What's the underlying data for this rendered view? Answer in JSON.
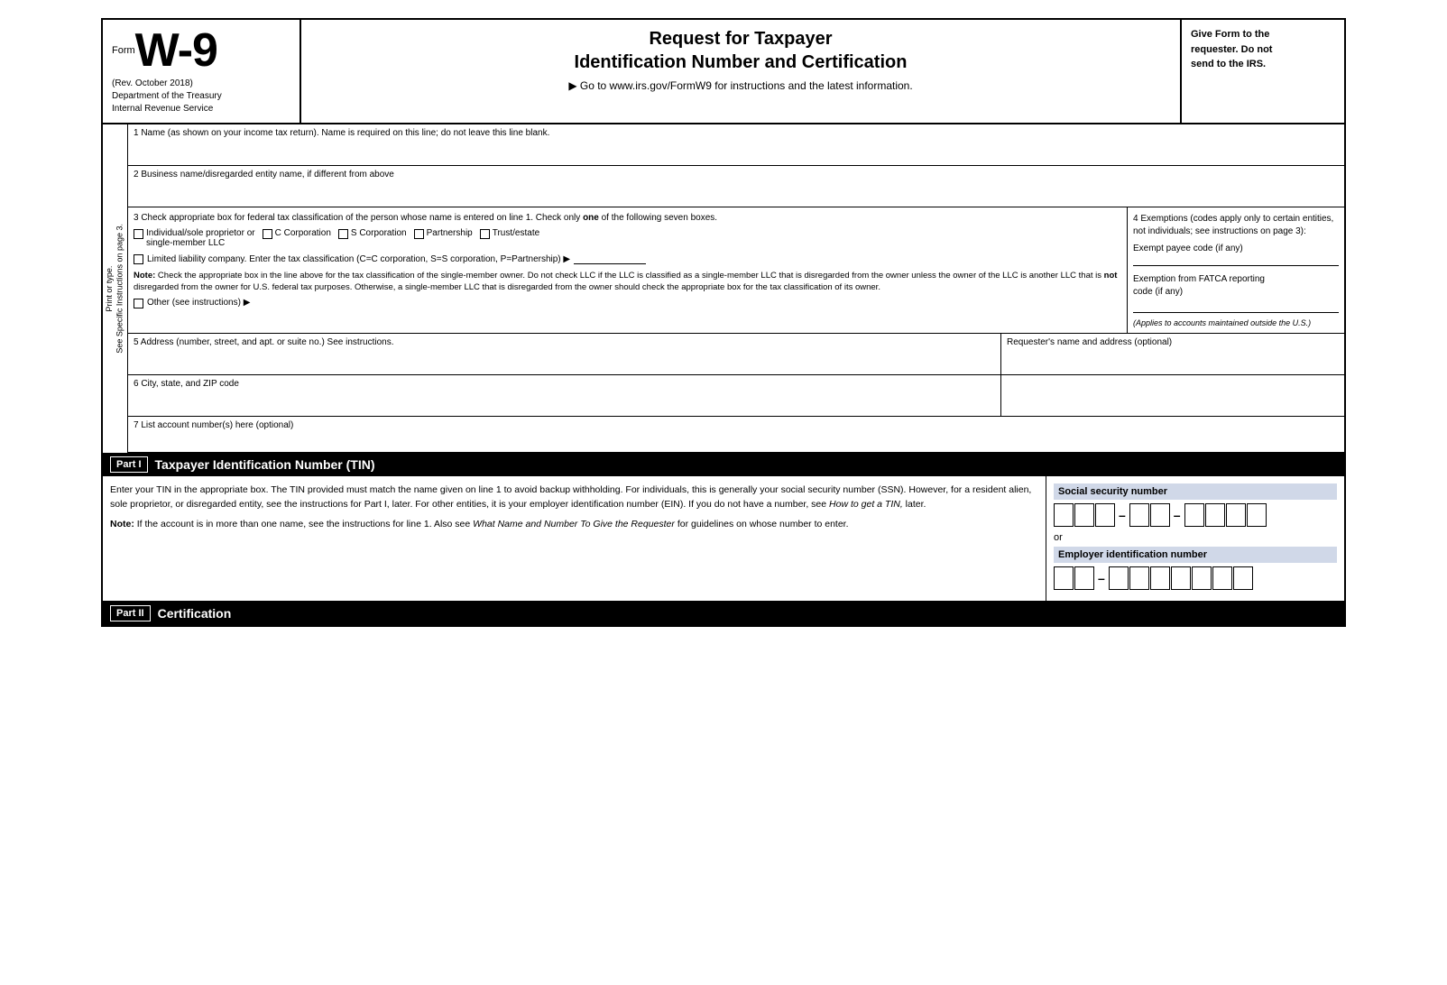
{
  "header": {
    "form_label": "Form",
    "form_number": "W-9",
    "rev_date": "(Rev. October 2018)",
    "dept": "Department of the Treasury",
    "service": "Internal Revenue Service",
    "title_line1": "Request for Taxpayer",
    "title_line2": "Identification Number and Certification",
    "goto_text": "▶ Go to www.irs.gov/FormW9 for instructions and the latest information.",
    "right_text_line1": "Give Form to the",
    "right_text_line2": "requester. Do not",
    "right_text_line3": "send to the IRS."
  },
  "fields": {
    "line1_label": "1  Name (as shown on your income tax return). Name is required on this line; do not leave this line blank.",
    "line2_label": "2  Business name/disregarded entity name, if different from above",
    "line3_label": "3  Check appropriate box for federal tax classification of the person whose name is entered on line 1. Check only",
    "line3_label_bold": "one",
    "line3_label2": "of the following seven boxes.",
    "check_individual": "Individual/sole proprietor or\nsingle-member LLC",
    "check_c_corp": "C Corporation",
    "check_s_corp": "S Corporation",
    "check_partnership": "Partnership",
    "check_trust": "Trust/estate",
    "check_llc_text": "Limited liability company. Enter the tax classification (C=C corporation, S=S corporation, P=Partnership) ▶",
    "note_label": "Note:",
    "note_text": "Check the appropriate box in the line above for the tax classification of the single-member owner. Do not check LLC if the LLC is classified as a single-member LLC that is disregarded from the owner unless the owner of the LLC is another LLC that is",
    "note_not": "not",
    "note_text2": "disregarded from the owner for U.S. federal tax purposes. Otherwise, a single-member LLC that is disregarded from the owner should check the appropriate box for the tax classification of its owner.",
    "check_other": "Other (see instructions) ▶",
    "line4_label": "4  Exemptions (codes apply only to certain entities, not individuals; see instructions on page 3):",
    "exempt_payee_label": "Exempt payee code (if any)",
    "fatca_label": "Exemption from FATCA reporting\ncode (if any)",
    "fatca_note": "(Applies to accounts maintained outside the U.S.)",
    "line5_label": "5  Address (number, street, and apt. or suite no.) See instructions.",
    "requester_label": "Requester's name and address (optional)",
    "line6_label": "6  City, state, and ZIP code",
    "line7_label": "7  List account number(s) here (optional)",
    "sideways1": "See Specific Instructions on page 3.",
    "sideways2": "Print or type."
  },
  "part1": {
    "label": "Part I",
    "title": "Taxpayer Identification Number (TIN)",
    "body_text": "Enter your TIN in the appropriate box. The TIN provided must match the name given on line 1 to avoid backup withholding. For individuals, this is generally your social security number (SSN). However, for a resident alien, sole proprietor, or disregarded entity, see the instructions for Part I, later. For other entities, it is your employer identification number (EIN). If you do not have a number, see",
    "how_get_tin": "How to get a TIN,",
    "body_text2": "later.",
    "note_label": "Note:",
    "note_text": "If the account is in more than one name, see the instructions for line 1. Also see",
    "what_name": "What Name and Number To Give the Requester",
    "note_text2": "for guidelines on whose number to enter.",
    "ssn_label": "Social security number",
    "ssn_cells": [
      "",
      "",
      "",
      "",
      "",
      "",
      "",
      "",
      ""
    ],
    "or_text": "or",
    "ein_label": "Employer identification number",
    "ein_cells": [
      "",
      "",
      "",
      "",
      "",
      "",
      "",
      "",
      ""
    ]
  },
  "part2": {
    "label": "Part II",
    "title": "Certification"
  }
}
